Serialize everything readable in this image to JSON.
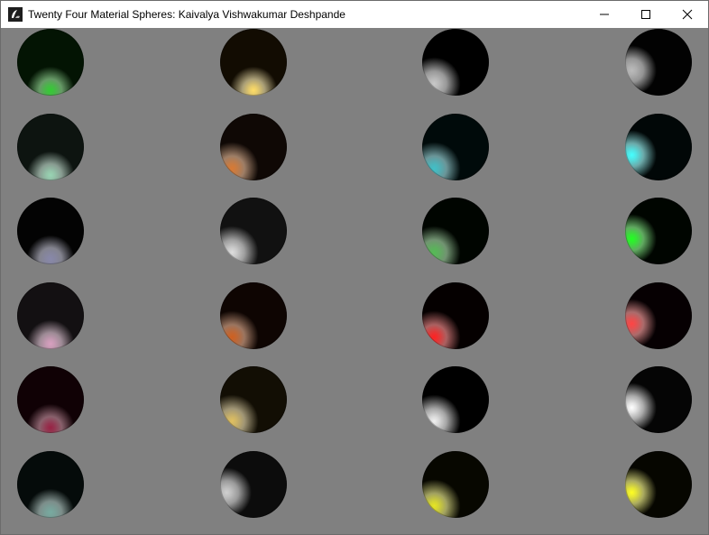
{
  "window": {
    "title": "Twenty Four Material Spheres: Kaivalya Vishwakumar Deshpande",
    "icon": "app-icon",
    "controls": [
      "minimize-icon",
      "maximize-icon",
      "close-icon"
    ]
  },
  "scene": {
    "background": "#808080",
    "spheres": [
      {
        "name": "sphere-emerald",
        "base": "#031403",
        "spec": "#33cc33",
        "light": "bottom"
      },
      {
        "name": "sphere-brass",
        "base": "#120c02",
        "spec": "#ffdd66",
        "light": "bottom"
      },
      {
        "name": "sphere-black-plastic",
        "base": "#000000",
        "spec": "#c8c8c8",
        "light": "bottom-left"
      },
      {
        "name": "sphere-black-rubber",
        "base": "#020202",
        "spec": "#bbbbbb",
        "light": "left"
      },
      {
        "name": "sphere-jade",
        "base": "#0d1410",
        "spec": "#99d4b3",
        "light": "bottom"
      },
      {
        "name": "sphere-bronze",
        "base": "#0f0805",
        "spec": "#d97a33",
        "light": "bottom-left"
      },
      {
        "name": "sphere-cyan-plastic",
        "base": "#000a0a",
        "spec": "#40c0c8",
        "light": "bottom-left"
      },
      {
        "name": "sphere-cyan-rubber",
        "base": "#010707",
        "spec": "#44ffff",
        "light": "left"
      },
      {
        "name": "sphere-obsidian",
        "base": "#030303",
        "spec": "#8888aa",
        "light": "bottom"
      },
      {
        "name": "sphere-chrome",
        "base": "#111111",
        "spec": "#dddddd",
        "light": "bottom-left"
      },
      {
        "name": "sphere-green-plastic",
        "base": "#000500",
        "spec": "#55bb55",
        "light": "bottom-left"
      },
      {
        "name": "sphere-green-rubber",
        "base": "#000500",
        "spec": "#22ff22",
        "light": "left"
      },
      {
        "name": "sphere-pearl",
        "base": "#131012",
        "spec": "#d8a0c0",
        "light": "bottom"
      },
      {
        "name": "sphere-copper",
        "base": "#0e0502",
        "spec": "#d06020",
        "light": "bottom-left"
      },
      {
        "name": "sphere-red-plastic",
        "base": "#050000",
        "spec": "#ff2222",
        "light": "bottom-left"
      },
      {
        "name": "sphere-red-rubber",
        "base": "#060002",
        "spec": "#ff4444",
        "light": "left"
      },
      {
        "name": "sphere-ruby",
        "base": "#100105",
        "spec": "#992244",
        "light": "bottom"
      },
      {
        "name": "sphere-gold",
        "base": "#120e04",
        "spec": "#e0c060",
        "light": "bottom-left"
      },
      {
        "name": "sphere-white-plastic",
        "base": "#000000",
        "spec": "#f0f0f0",
        "light": "bottom-left"
      },
      {
        "name": "sphere-white-rubber",
        "base": "#050505",
        "spec": "#ffffff",
        "light": "left"
      },
      {
        "name": "sphere-turquoise",
        "base": "#050b0a",
        "spec": "#77aaa0",
        "light": "bottom"
      },
      {
        "name": "sphere-silver",
        "base": "#0c0c0c",
        "spec": "#cfcfcf",
        "light": "left"
      },
      {
        "name": "sphere-yellow-plastic",
        "base": "#070700",
        "spec": "#e6e622",
        "light": "bottom-left"
      },
      {
        "name": "sphere-yellow-rubber",
        "base": "#060600",
        "spec": "#ffff22",
        "light": "left"
      }
    ]
  }
}
